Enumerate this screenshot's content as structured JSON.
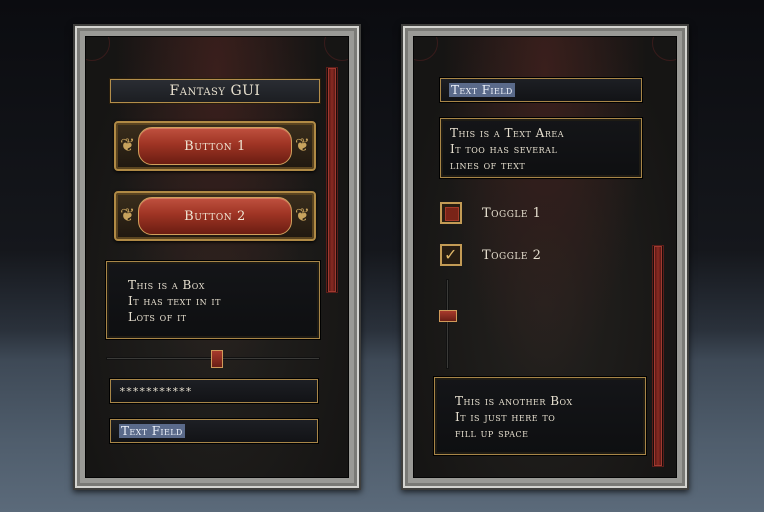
{
  "left_panel": {
    "title": "Fantasy GUI",
    "button1": "Button 1",
    "button2": "Button 2",
    "box_lines": [
      "This is a Box",
      "It has text in it",
      "Lots of it"
    ],
    "horizontal_slider_value": 0.52,
    "password_field_value": "***********",
    "text_field_value": "Text Field",
    "scrollbar_position": 0.0
  },
  "right_panel": {
    "text_field_value": "Text Field",
    "text_area_lines": [
      "This is a Text Area",
      "It too has several",
      "lines of text"
    ],
    "toggle1": {
      "label": "Toggle 1",
      "checked": false
    },
    "toggle2": {
      "label": "Toggle 2",
      "checked": true
    },
    "vertical_slider_value": 0.4,
    "box_lines": [
      "This is another Box",
      "It is just here to",
      "fill up space"
    ],
    "scrollbar_position": 1.0
  },
  "colors": {
    "accent_gold": "#b08a45",
    "button_red": "#9e3424",
    "selection_blue": "#5a6a8a"
  }
}
